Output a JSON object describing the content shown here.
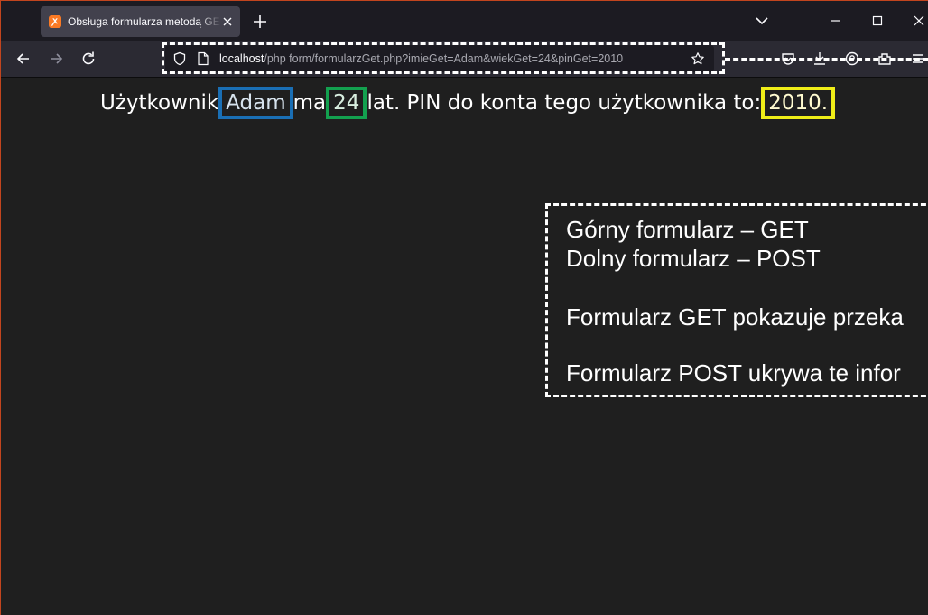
{
  "browser": {
    "tab": {
      "title": "Obsługa formularza metodą GET",
      "favicon": "xampp-icon"
    },
    "new_tab_icon": "plus-icon",
    "window_controls": [
      "minimize-icon",
      "maximize-icon",
      "close-icon"
    ],
    "nav": {
      "back": "back-arrow-icon",
      "forward": "forward-arrow-icon",
      "reload": "reload-icon"
    },
    "url": {
      "host": "localhost",
      "path": "/php form/formularzGet.php?imieGet=Adam&wiekGet=24&pinGet=2010"
    },
    "toolbar_icons": [
      "pocket-icon",
      "downloads-icon",
      "account-icon",
      "extensions-icon",
      "menu-icon"
    ]
  },
  "page": {
    "sentence": {
      "part1": "Użytkownik",
      "name": "Adam",
      "part2": "ma",
      "age": "24",
      "part3": "lat. PIN do konta tego użytkownika to:",
      "pin": "2010",
      "end": "."
    },
    "note": {
      "line1": "Górny formularz – GET",
      "line2": "Dolny formularz – POST",
      "line3": "Formularz GET pokazuje przeka",
      "line4": "Formularz POST ukrywa te infor"
    }
  },
  "colors": {
    "highlight_name": "#1a6fb5",
    "highlight_age": "#13a14f",
    "highlight_pin": "#f0ee18",
    "annotation": "#ffffff",
    "background": "#1f1f1f"
  }
}
